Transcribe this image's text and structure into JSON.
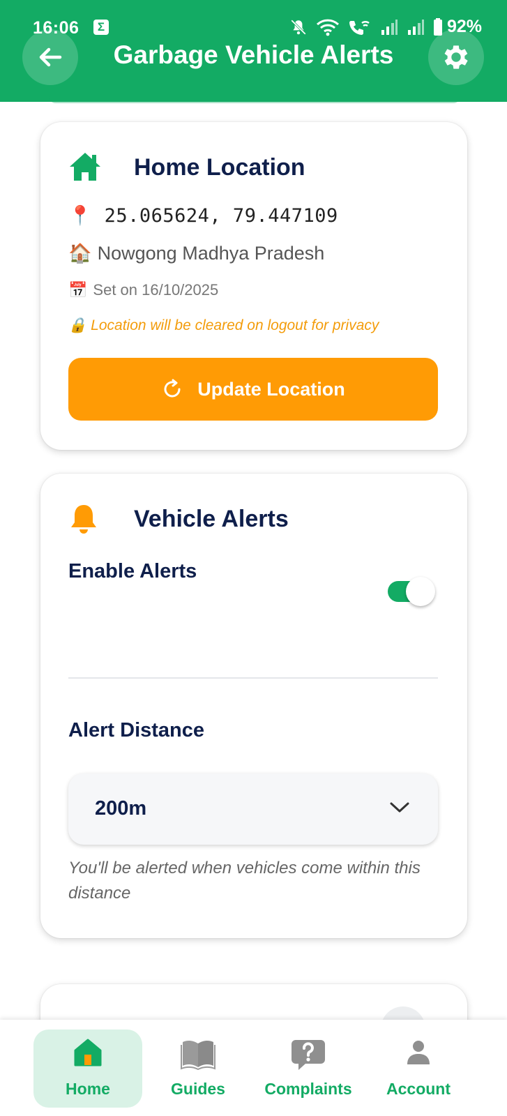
{
  "status_bar": {
    "time": "16:06",
    "app_badge": "Σ",
    "battery": "92%"
  },
  "header": {
    "title": "Garbage Vehicle Alerts",
    "color": "#13ab64"
  },
  "home_location": {
    "title": "Home Location",
    "pin_emoji": "📍",
    "coordinates": "25.065624, 79.447109",
    "house_emoji": "🏠",
    "address": "Nowgong Madhya Pradesh",
    "calendar_emoji": "📅",
    "set_on": "Set on 16/10/2025",
    "lock_emoji": "🔒",
    "privacy_note": "Location will be cleared on logout for privacy",
    "update_button": "Update Location"
  },
  "vehicle_alerts": {
    "title": "Vehicle Alerts",
    "enable_label": "Enable Alerts",
    "enabled": true,
    "distance_label": "Alert Distance",
    "distance_value": "200m",
    "helper_text": "You'll be alerted when vehicles come within this distance"
  },
  "bottom_nav": {
    "items": [
      {
        "label": "Home",
        "icon": "home-icon",
        "active": true
      },
      {
        "label": "Guides",
        "icon": "book-icon",
        "active": false
      },
      {
        "label": "Complaints",
        "icon": "question-bubble-icon",
        "active": false
      },
      {
        "label": "Account",
        "icon": "person-icon",
        "active": false
      }
    ]
  },
  "colors": {
    "primary": "#13ab64",
    "accent": "#ff9b05",
    "text_dark": "#0f1f4b"
  }
}
